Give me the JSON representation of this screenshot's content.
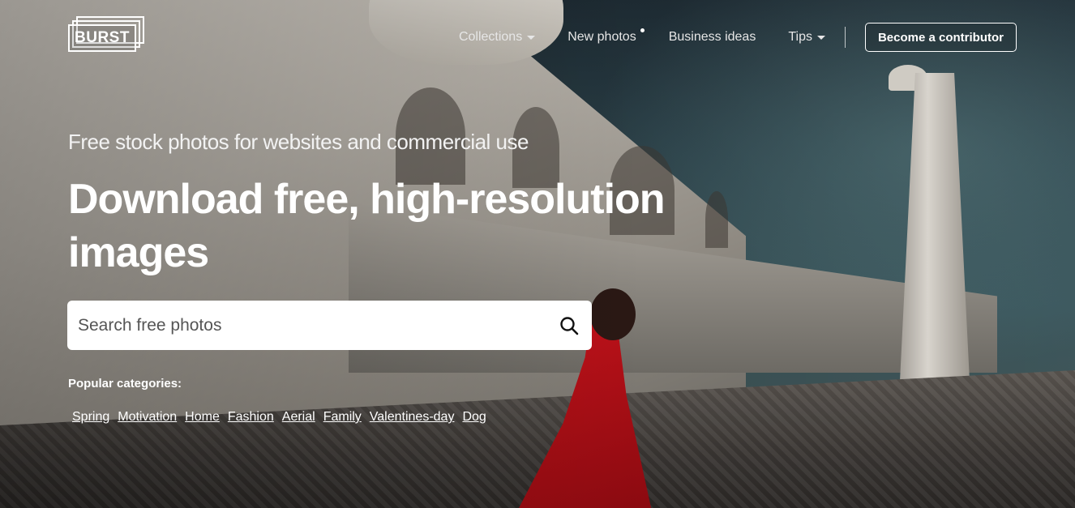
{
  "logo": {
    "text": "BURST"
  },
  "nav": {
    "collections": "Collections",
    "new_photos": "New photos",
    "business_ideas": "Business ideas",
    "tips": "Tips",
    "contributor_button": "Become a contributor"
  },
  "hero": {
    "subtitle": "Free stock photos for websites and commercial use",
    "headline": "Download free, high-resolution images"
  },
  "search": {
    "placeholder": "Search free photos",
    "value": ""
  },
  "popular": {
    "label": "Popular categories:",
    "categories": [
      "Spring",
      "Motivation",
      "Home",
      "Fashion",
      "Aerial",
      "Family",
      "Valentines-day",
      "Dog"
    ]
  }
}
